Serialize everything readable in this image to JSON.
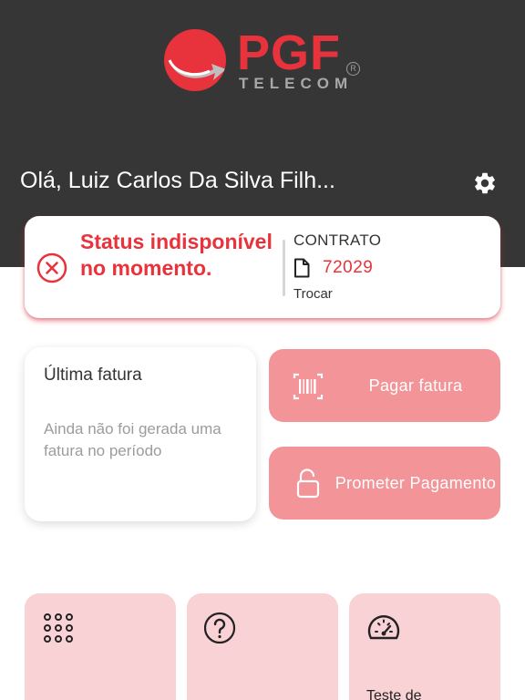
{
  "brand": {
    "logo_text": "PGF",
    "logo_subtitle": "TELECOM",
    "registered_mark": "R"
  },
  "header": {
    "greeting": "Olá, Luiz Carlos Da Silva Filh...",
    "settings_icon": "gear-icon"
  },
  "status_card": {
    "status_icon": "error-circle-icon",
    "status_text": "Status indisponível no momento.",
    "contract_label": "CONTRATO",
    "contract_icon": "document-icon",
    "contract_number": "72029",
    "switch_label": "Trocar"
  },
  "invoice": {
    "title": "Última fatura",
    "empty_message": "Ainda não foi gerada uma fatura no período"
  },
  "actions": {
    "pay": {
      "label": "Pagar fatura",
      "icon": "barcode-icon"
    },
    "promise": {
      "label": "Prometer Pagamento",
      "icon": "unlock-icon"
    }
  },
  "tiles": [
    {
      "icon": "keypad-icon",
      "label": ""
    },
    {
      "icon": "help-icon",
      "label": ""
    },
    {
      "icon": "speedometer-icon",
      "label": "Teste de"
    }
  ],
  "colors": {
    "header_bg": "#363636",
    "accent_red": "#e8323c",
    "button_pink": "#f29498",
    "tile_pink": "#f8d2d4"
  }
}
